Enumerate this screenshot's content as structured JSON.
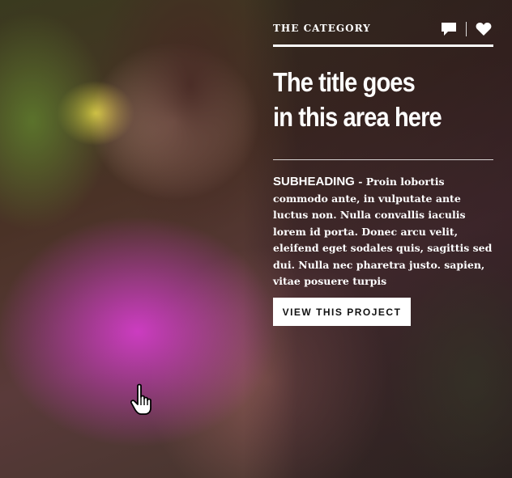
{
  "card": {
    "category": "THE CATEGORY",
    "title_lines": [
      "The title goes",
      "in this area here"
    ],
    "subheading": "SUBHEADING",
    "separator": " - ",
    "body": "Proin lobortis commodo ante, in vulputate ante luctus non. Nulla convallis iaculis lorem id porta. Donec arcu velit, eleifend eget sodales quis, sagittis sed dui. Nulla nec pharetra justo. sapien, vitae posuere turpis",
    "cta_label": "VIEW THIS PROJECT"
  },
  "icons": {
    "comment": "comment-icon",
    "like": "heart-icon",
    "cursor": "hand-pointer-cursor-icon"
  },
  "colors": {
    "text": "#ffffff",
    "button_bg": "#ffffff",
    "button_text": "#111111",
    "accent_magenta": "#d23cc8"
  }
}
